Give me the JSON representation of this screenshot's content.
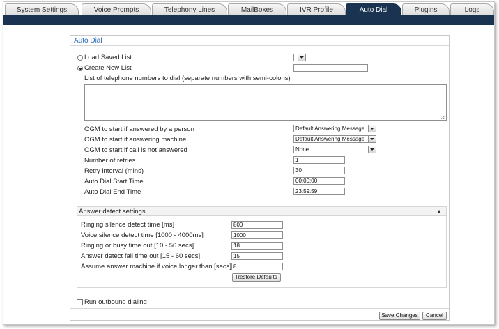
{
  "tabs": [
    {
      "label": "System Settings",
      "active": false
    },
    {
      "label": "Voice Prompts",
      "active": false
    },
    {
      "label": "Telephony Lines",
      "active": false
    },
    {
      "label": "MailBoxes",
      "active": false
    },
    {
      "label": "IVR Profile",
      "active": false
    },
    {
      "label": "Auto Dial",
      "active": true
    },
    {
      "label": "Plugins",
      "active": false
    },
    {
      "label": "Logs",
      "active": false
    }
  ],
  "panel": {
    "title": "Auto Dial",
    "load_saved_list_label": "Load Saved List",
    "create_new_list_label": "Create New List",
    "selected_mode": "create_new_list",
    "new_list_name": "",
    "numbers_caption": "List of telephone numbers to dial (separate numbers with semi-colons)",
    "numbers_value": "",
    "ogm_person_label": "OGM to start if answered by a person",
    "ogm_person_value": "Default Answering Message",
    "ogm_machine_label": "OGM to start if answering machine",
    "ogm_machine_value": "Default Answering Message",
    "ogm_noanswer_label": "OGM to start if call is not answered",
    "ogm_noanswer_value": "None",
    "retries_label": "Number of retries",
    "retries_value": "1",
    "retry_interval_label": "Retry interval (mins)",
    "retry_interval_value": "30",
    "start_time_label": "Auto Dial Start Time",
    "start_time_value": "00:00:00",
    "end_time_label": "Auto Dial End Time",
    "end_time_value": "23:59:59"
  },
  "answer_detect": {
    "title": "Answer detect settings",
    "ringing_silence_label": "Ringing silence detect time [ms]",
    "ringing_silence_value": "800",
    "voice_silence_label": "Voice silence detect time [1000 - 4000ms]",
    "voice_silence_value": "1000",
    "busy_timeout_label": "Ringing or busy time out [10 - 50 secs]",
    "busy_timeout_value": "18",
    "fail_timeout_label": "Answer detect fail time out [15 - 60 secs]",
    "fail_timeout_value": "15",
    "machine_voice_label": "Assume answer machine if voice longer than [secs]",
    "machine_voice_value": "8",
    "restore_defaults_label": "Restore Defaults"
  },
  "run_outbound_label": "Run outbound dialing",
  "run_outbound_checked": false,
  "footer": {
    "save_label": "Save Changes",
    "cancel_label": "Cancel"
  },
  "colors": {
    "nav": "#1a3350",
    "title_blue": "#2a6ab4"
  }
}
